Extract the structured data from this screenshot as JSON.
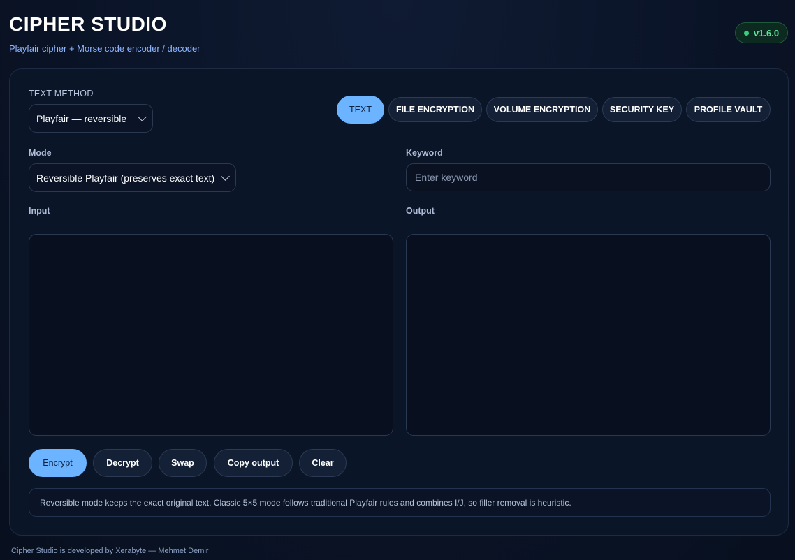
{
  "app": {
    "title": "CIPHER STUDIO",
    "subtitle": "Playfair cipher + Morse code encoder / decoder",
    "version": "v1.6.0"
  },
  "text_method": {
    "label": "TEXT METHOD",
    "selected": "Playfair — reversible"
  },
  "tabs": [
    {
      "label": "TEXT",
      "active": true
    },
    {
      "label": "FILE ENCRYPTION",
      "active": false
    },
    {
      "label": "VOLUME ENCRYPTION",
      "active": false
    },
    {
      "label": "SECURITY KEY",
      "active": false
    },
    {
      "label": "PROFILE VAULT",
      "active": false
    }
  ],
  "mode": {
    "label": "Mode",
    "selected": "Reversible Playfair (preserves exact text)"
  },
  "keyword": {
    "label": "Keyword",
    "placeholder": "Enter keyword",
    "value": ""
  },
  "input": {
    "label": "Input",
    "value": ""
  },
  "output": {
    "label": "Output",
    "value": ""
  },
  "actions": {
    "encrypt": "Encrypt",
    "decrypt": "Decrypt",
    "swap": "Swap",
    "copy_output": "Copy output",
    "clear": "Clear"
  },
  "note": "Reversible mode keeps the exact original text. Classic 5×5 mode follows traditional Playfair rules and combines I/J, so filler removal is heuristic.",
  "footer": "Cipher Studio is developed by Xerabyte — Mehmet Demir",
  "colors": {
    "accent": "#6cb4ff",
    "background": "#0a1326",
    "version_green": "#5fe39a"
  }
}
